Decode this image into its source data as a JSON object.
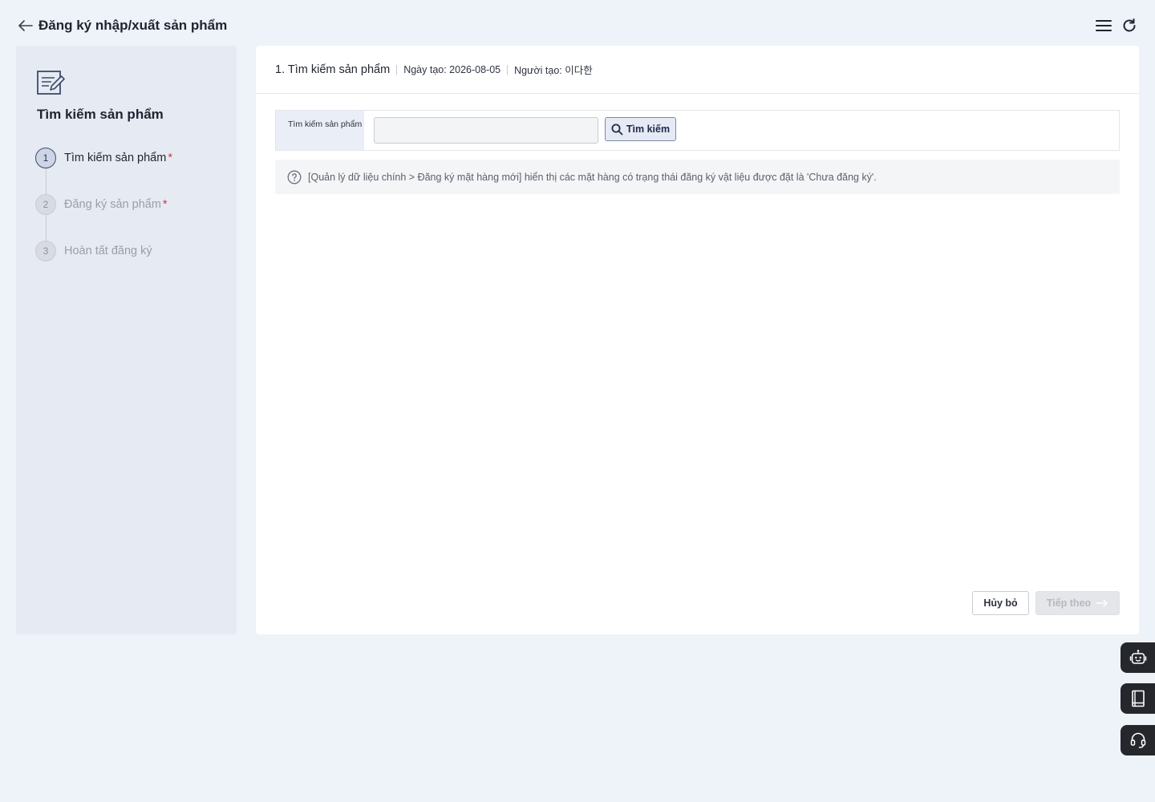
{
  "header": {
    "title": "Đăng ký nhập/xuất sản phẩm",
    "back_icon": "arrow-left-icon",
    "menu_icon": "hamburger-menu-icon",
    "refresh_icon": "refresh-icon"
  },
  "sidebar": {
    "icon": "document-edit-icon",
    "title": "Tìm kiếm sản phẩm",
    "steps": [
      {
        "number": "1",
        "label": "Tìm kiếm sản phẩm",
        "required": "*",
        "state": "active"
      },
      {
        "number": "2",
        "label": "Đăng ký sản phẩm",
        "required": "*",
        "state": "inactive"
      },
      {
        "number": "3",
        "label": "Hoàn tất đăng ký",
        "required": "",
        "state": "inactive"
      }
    ]
  },
  "panel": {
    "title": "1. Tìm kiếm sản phẩm",
    "created_date": "Ngày tạo: 2026-08-05",
    "creator": "Người tạo: 이다한",
    "search": {
      "label": "Tìm kiếm sản phẩm",
      "value": "",
      "placeholder": "",
      "button_label": "Tìm kiếm"
    },
    "info_text": "[Quản lý dữ liệu chính > Đăng ký mặt hàng mới] hiển thị các mặt hàng có trạng thái đăng ký vật liệu được đặt là 'Chưa đăng ký'.",
    "cancel_label": "Hủy bỏ",
    "next_label": "Tiếp theo"
  },
  "floating_buttons": [
    "chatbot-icon",
    "manual-book-icon",
    "headset-support-icon"
  ],
  "colors": {
    "background": "#eef2f9",
    "sidebar_bg": "#e6eaf3",
    "accent": "#3d4a6b",
    "required": "#e0323f",
    "float_bg": "#25272c"
  }
}
